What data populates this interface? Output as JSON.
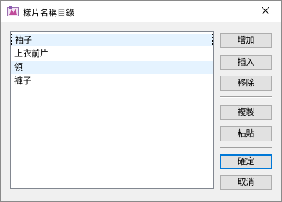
{
  "window": {
    "title": "樣片名稱目錄",
    "app_icon": "pattern-app-icon",
    "close_icon": "close-icon"
  },
  "list": {
    "items": [
      "袖子",
      "上衣前片",
      "領",
      "褲子"
    ],
    "selected_index": 0,
    "hover_index": 2
  },
  "buttons": {
    "add": "增加",
    "insert": "插入",
    "remove": "移除",
    "copy": "複製",
    "paste": "粘貼",
    "ok": "確定",
    "cancel": "取消"
  },
  "colors": {
    "default_button_border": "#0078d7",
    "item_highlight": "#e5f3ff",
    "dialog_background": "#f0f0f0"
  }
}
